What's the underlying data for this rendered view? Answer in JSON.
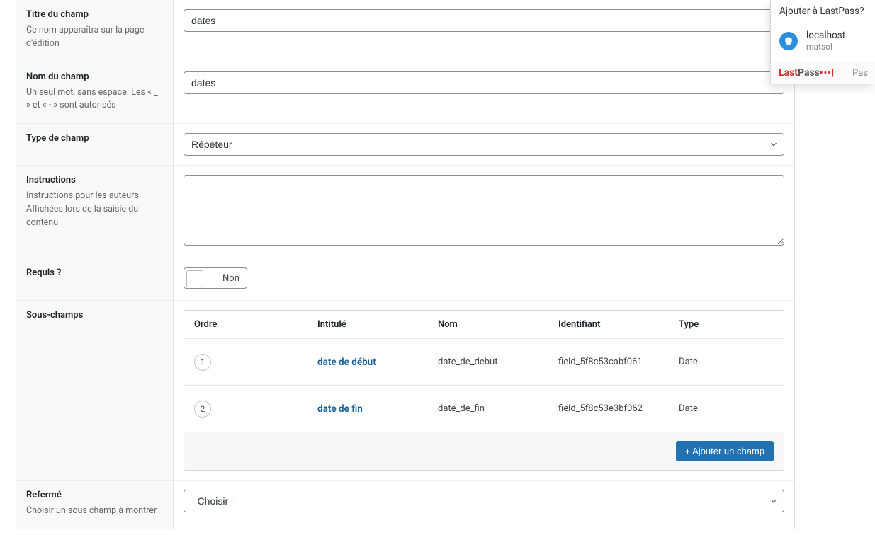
{
  "rows": {
    "titre": {
      "label": "Titre du champ",
      "desc": "Ce nom apparaîtra sur la page d'édition",
      "value": "dates"
    },
    "nom": {
      "label": "Nom du champ",
      "desc": "Un seul mot, sans espace. Les « _ » et « - » sont autorisés",
      "value": "dates"
    },
    "type": {
      "label": "Type de champ",
      "value": "Répéteur"
    },
    "instructions": {
      "label": "Instructions",
      "desc": "Instructions pour les auteurs. Affichées lors de la saisie du contenu",
      "value": ""
    },
    "requis": {
      "label": "Requis ?",
      "toggle_text": "Non"
    },
    "sous_champs": {
      "label": "Sous-champs",
      "headers": {
        "ordre": "Ordre",
        "intitule": "Intitulé",
        "nom": "Nom",
        "identifiant": "Identifiant",
        "type": "Type"
      },
      "items": [
        {
          "order": "1",
          "intitule": "date de début",
          "nom": "date_de_debut",
          "identifiant": "field_5f8c53cabf061",
          "type": "Date"
        },
        {
          "order": "2",
          "intitule": "date de fin",
          "nom": "date_de_fin",
          "identifiant": "field_5f8c53e3bf062",
          "type": "Date"
        }
      ],
      "add_button": "+ Ajouter un champ"
    },
    "referme": {
      "label": "Refermé",
      "desc": "Choisir un sous champ à montrer",
      "value": "- Choisir -"
    }
  },
  "lastpass": {
    "title": "Ajouter à LastPass?",
    "host": "localhost",
    "user": "matsol",
    "logo_last": "Last",
    "logo_pass": "Pass",
    "dots": "•••|",
    "pas": "Pas"
  }
}
